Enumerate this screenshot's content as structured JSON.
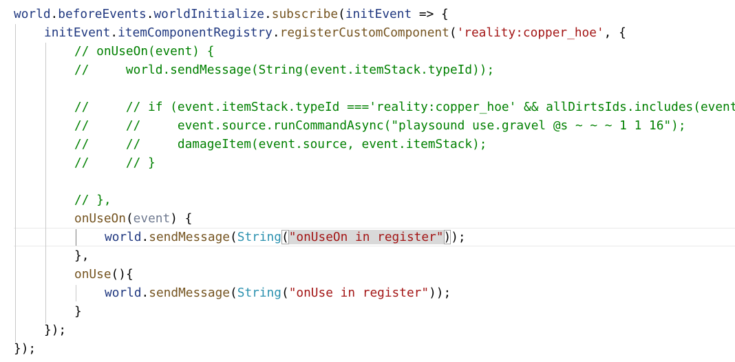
{
  "editor": {
    "lines": [
      [
        {
          "t": "world",
          "c": "ident"
        },
        {
          "t": ".",
          "c": "punct"
        },
        {
          "t": "beforeEvents",
          "c": "prop"
        },
        {
          "t": ".",
          "c": "punct"
        },
        {
          "t": "worldInitialize",
          "c": "prop"
        },
        {
          "t": ".",
          "c": "punct"
        },
        {
          "t": "subscribe",
          "c": "method"
        },
        {
          "t": "(",
          "c": "punct"
        },
        {
          "t": "initEvent",
          "c": "ident"
        },
        {
          "t": " => {",
          "c": "punct"
        }
      ],
      [
        {
          "t": "initEvent",
          "c": "ident"
        },
        {
          "t": ".",
          "c": "punct"
        },
        {
          "t": "itemComponentRegistry",
          "c": "prop"
        },
        {
          "t": ".",
          "c": "punct"
        },
        {
          "t": "registerCustomComponent",
          "c": "method"
        },
        {
          "t": "(",
          "c": "punct"
        },
        {
          "t": "'reality:copper_hoe'",
          "c": "string"
        },
        {
          "t": ", {",
          "c": "punct"
        }
      ],
      [
        {
          "t": "// onUseOn(event) {",
          "c": "comment"
        }
      ],
      [
        {
          "t": "//     world.sendMessage(String(event.itemStack.typeId));",
          "c": "comment"
        }
      ],
      [],
      [
        {
          "t": "//     // if (event.itemStack.typeId ==='reality:copper_hoe' && allDirtsIds.includes(event",
          "c": "comment"
        }
      ],
      [
        {
          "t": "//     //     event.source.runCommandAsync(\"playsound use.gravel @s ~ ~ ~ 1 1 16\");",
          "c": "comment"
        }
      ],
      [
        {
          "t": "//     //     damageItem(event.source, event.itemStack);",
          "c": "comment"
        }
      ],
      [
        {
          "t": "//     // }",
          "c": "comment"
        }
      ],
      [],
      [
        {
          "t": "// },",
          "c": "comment"
        }
      ],
      [
        {
          "t": "onUseOn",
          "c": "method"
        },
        {
          "t": "(",
          "c": "punct"
        },
        {
          "t": "event",
          "c": "unused"
        },
        {
          "t": ") {",
          "c": "punct"
        }
      ],
      [
        {
          "t": "world",
          "c": "ident"
        },
        {
          "t": ".",
          "c": "punct"
        },
        {
          "t": "sendMessage",
          "c": "method"
        },
        {
          "t": "(",
          "c": "punct"
        },
        {
          "t": "String",
          "c": "type"
        },
        {
          "t": "(",
          "c": "punct",
          "m": "br"
        },
        {
          "t": "\"onUseOn in register\"",
          "c": "string",
          "m": "sel"
        },
        {
          "t": ")",
          "c": "punct",
          "m": "br"
        },
        {
          "t": ");",
          "c": "punct"
        }
      ],
      [
        {
          "t": "},",
          "c": "punct"
        }
      ],
      [
        {
          "t": "onUse",
          "c": "method"
        },
        {
          "t": "(){",
          "c": "punct"
        }
      ],
      [
        {
          "t": "world",
          "c": "ident"
        },
        {
          "t": ".",
          "c": "punct"
        },
        {
          "t": "sendMessage",
          "c": "method"
        },
        {
          "t": "(",
          "c": "punct"
        },
        {
          "t": "String",
          "c": "type"
        },
        {
          "t": "(",
          "c": "punct"
        },
        {
          "t": "\"onUse in register\"",
          "c": "string"
        },
        {
          "t": "));",
          "c": "punct"
        }
      ],
      [
        {
          "t": "}",
          "c": "punct"
        }
      ],
      [
        {
          "t": "});",
          "c": "punct"
        }
      ],
      [
        {
          "t": "});",
          "c": "punct"
        }
      ]
    ]
  },
  "colors": {
    "ident": "#1f377f",
    "prop": "#1f377f",
    "method": "#74531f",
    "string": "#a31515",
    "comment": "#008000",
    "type": "#2b91af",
    "unused": "#6f7a90",
    "punct": "#000000",
    "selection": "#d9d9d9",
    "indent_guide": "#c8c8c8",
    "background": "#ffffff"
  }
}
